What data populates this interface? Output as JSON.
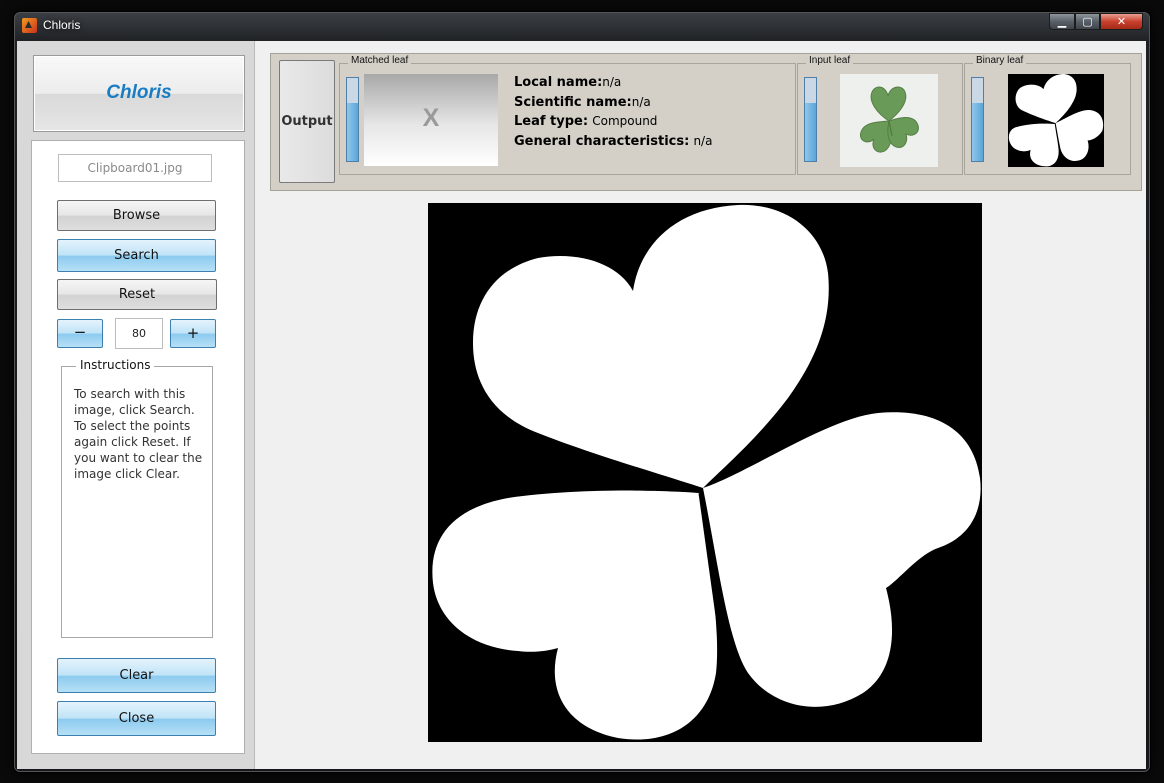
{
  "window": {
    "title": "Chloris"
  },
  "caption": {
    "minimize": "▁",
    "maximize": "▢",
    "close": "✕"
  },
  "sidebar": {
    "brand": "Chloris",
    "file_name": "Clipboard01.jpg",
    "browse_label": "Browse",
    "search_label": "Search",
    "reset_label": "Reset",
    "minus_label": "−",
    "plus_label": "+",
    "threshold_value": "80",
    "instructions_title": "Instructions",
    "instructions_text": "To search with this image, click Search. To select the points again click Reset. If you want to clear the image click Clear.",
    "clear_label": "Clear",
    "close_label": "Close"
  },
  "output": {
    "button_label": "Output",
    "matched_title": "Matched leaf",
    "matched_placeholder": "X",
    "input_title": "Input leaf",
    "binary_title": "Binary leaf",
    "local_name_label": "Local name:",
    "local_name_value": "n/a",
    "scientific_name_label": "Scientific name:",
    "scientific_name_value": "n/a",
    "leaf_type_label": "Leaf type:",
    "leaf_type_value": "Compound",
    "general_label": "General characteristics:",
    "general_value": "n/a"
  },
  "sliders": {
    "matched_level": 0.7,
    "input_level": 0.7,
    "binary_level": 0.7
  },
  "colors": {
    "brand": "#1a7dc3",
    "blue_button": "#8ccaef",
    "panel": "#d4d0c8",
    "leaf_green": "#6a9a58"
  }
}
